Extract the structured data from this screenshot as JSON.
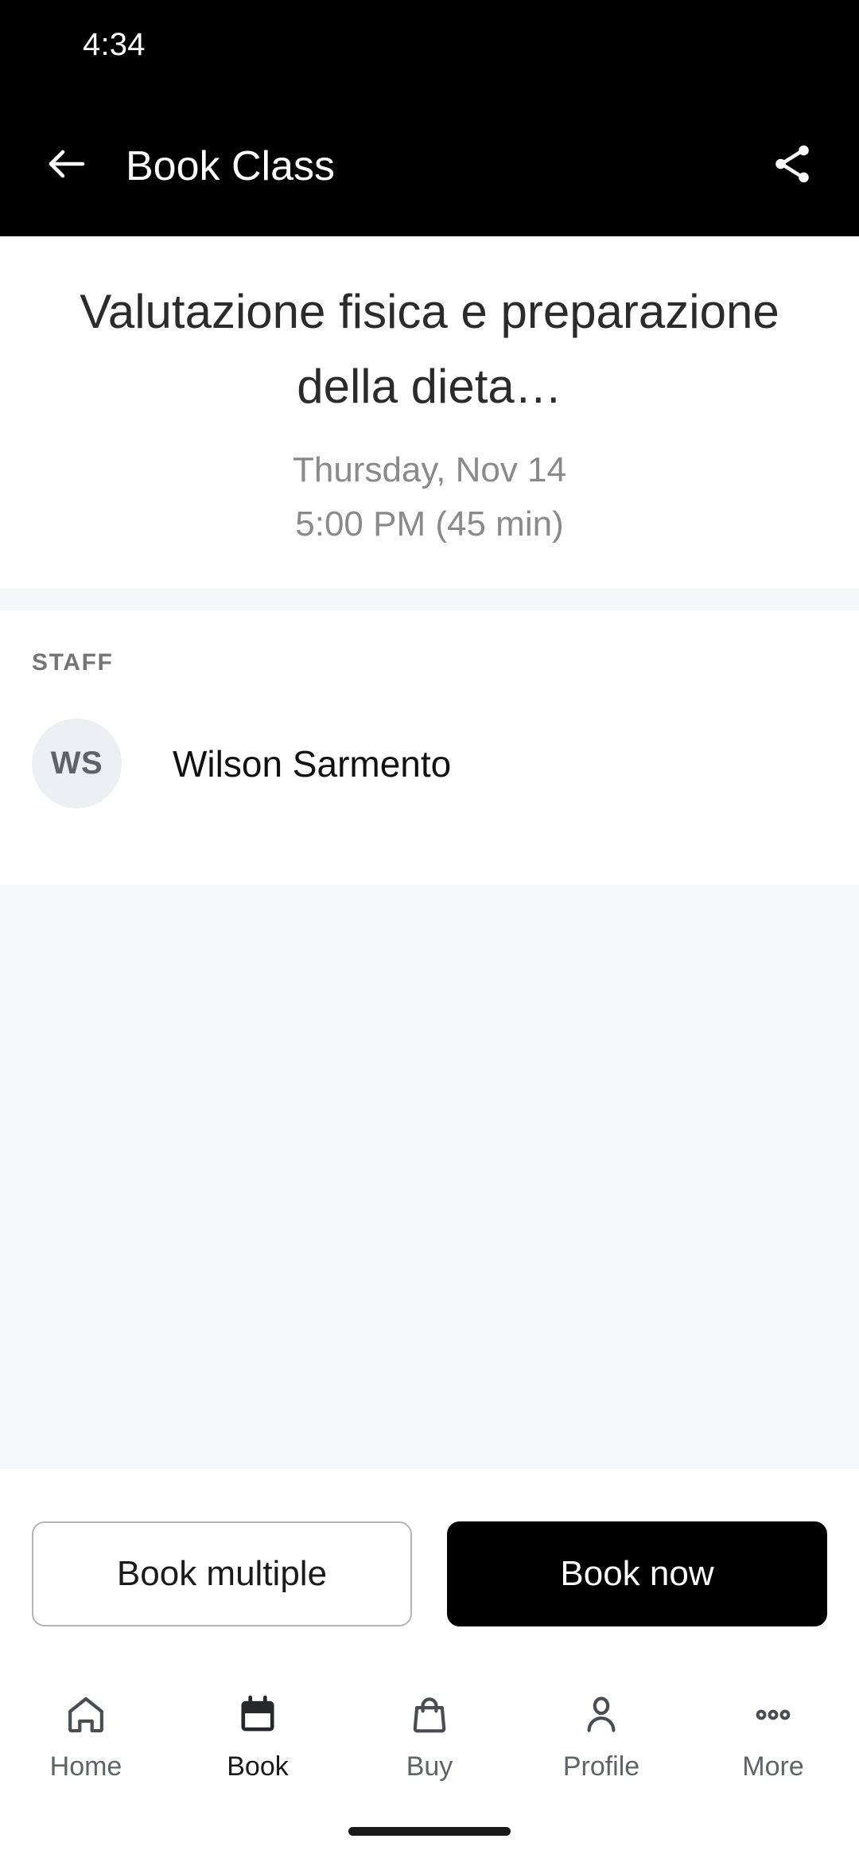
{
  "status_bar": {
    "time": "4:34"
  },
  "app_bar": {
    "title": "Book Class",
    "back_icon": "arrow-left-icon",
    "share_icon": "share-icon"
  },
  "class": {
    "title": "Valutazione fisica e preparazione della dieta…",
    "date": "Thursday, Nov 14",
    "time": "5:00 PM (45 min)"
  },
  "staff": {
    "section_label": "STAFF",
    "members": [
      {
        "initials": "WS",
        "name": "Wilson Sarmento"
      }
    ]
  },
  "actions": {
    "secondary_label": "Book multiple",
    "primary_label": "Book now"
  },
  "bottom_nav": {
    "items": [
      {
        "label": "Home",
        "icon": "home-icon",
        "active": false
      },
      {
        "label": "Book",
        "icon": "calendar-icon",
        "active": true
      },
      {
        "label": "Buy",
        "icon": "shopping-bag-icon",
        "active": false
      },
      {
        "label": "Profile",
        "icon": "person-icon",
        "active": false
      },
      {
        "label": "More",
        "icon": "more-horizontal-icon",
        "active": false
      }
    ]
  },
  "colors": {
    "app_bar_background": "#000000",
    "primary_button": "#000000",
    "page_background": "#ffffff",
    "filler_background": "#f7f8fa",
    "divider": "#f5f7fa",
    "muted_text": "#8a8a8a",
    "avatar_background": "#edeff2"
  }
}
